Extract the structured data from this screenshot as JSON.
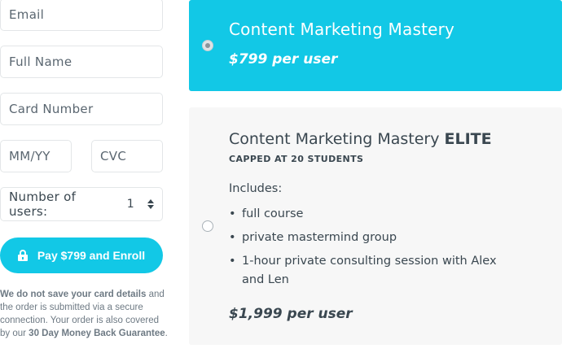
{
  "form": {
    "email_placeholder": "Email",
    "fullname_placeholder": "Full Name",
    "card_placeholder": "Card Number",
    "expiry_placeholder": "MM/YY",
    "cvc_placeholder": "CVC",
    "users_label": "Number of users:",
    "users_value": "1",
    "pay_button_label": "Pay $799 and Enroll",
    "notice_bold_1": "We do not save your card details",
    "notice_text_1": " and the order is submitted via a secure connection. Your order is also covered by our ",
    "notice_bold_2": "30 Day Money Back Guarantee",
    "notice_text_2": "."
  },
  "plans": {
    "standard": {
      "title": "Content Marketing Mastery",
      "price": "$799 per user",
      "selected": true
    },
    "elite": {
      "title_prefix": "Content Marketing Mastery ",
      "title_emphasis": "ELITE",
      "cap": "CAPPED AT 20 STUDENTS",
      "includes_label": "Includes:",
      "items": [
        "full course",
        "private mastermind group",
        "1-hour private consulting session with Alex and Len"
      ],
      "price": "$1,999 per user",
      "selected": false
    }
  },
  "colors": {
    "accent": "#12c8e6",
    "text": "#3a4750",
    "muted": "#6e7a84",
    "card_bg": "#f7f7f7"
  },
  "icons": {
    "lock": "lock-icon",
    "spinner": "stepper-arrows-icon"
  }
}
